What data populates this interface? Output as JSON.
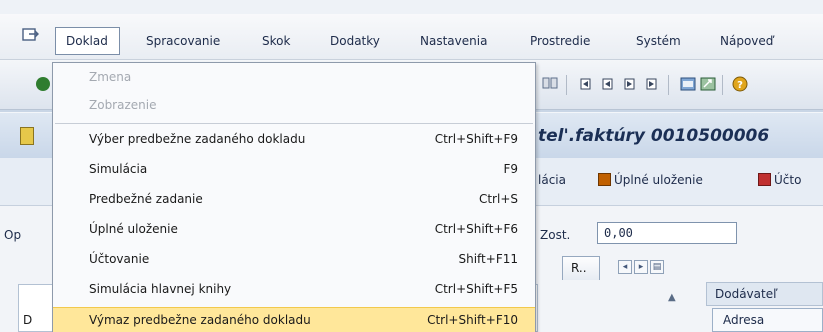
{
  "menubar": {
    "items": [
      {
        "label": "Doklad"
      },
      {
        "label": "Spracovanie"
      },
      {
        "label": "Skok"
      },
      {
        "label": "Dodatky"
      },
      {
        "label": "Nastavenia"
      },
      {
        "label": "Prostredie"
      },
      {
        "label": "Systém"
      },
      {
        "label": "Nápoveď"
      }
    ]
  },
  "title": {
    "text": "tel'.faktúry 0010500006"
  },
  "app_toolbar": {
    "simulacia_partial": "lácia",
    "full_save": "Úplné uloženie",
    "post_partial": "Účto"
  },
  "form": {
    "op_label": "Op",
    "zost_label": "Zost.",
    "zost_value": "0,00",
    "tab_r_label": "R..",
    "dodavatel_header": "Dodávateľ",
    "adresa_label": "Adresa",
    "left_panel_letter": "D"
  },
  "dropdown": {
    "items": [
      {
        "label": "Zmena",
        "shortcut": "",
        "disabled": true
      },
      {
        "label": "Zobrazenie",
        "shortcut": "",
        "disabled": true
      },
      {
        "label": "Výber predbežne zadaného dokladu",
        "shortcut": "Ctrl+Shift+F9",
        "disabled": false
      },
      {
        "label": "Simulácia",
        "shortcut": "F9",
        "disabled": false
      },
      {
        "label": "Predbežné zadanie",
        "shortcut": "Ctrl+S",
        "disabled": false
      },
      {
        "label": "Úplné uloženie",
        "shortcut": "Ctrl+Shift+F6",
        "disabled": false
      },
      {
        "label": "Účtovanie",
        "shortcut": "Shift+F11",
        "disabled": false
      },
      {
        "label": "Simulácia hlavnej knihy",
        "shortcut": "Ctrl+Shift+F5",
        "disabled": false
      },
      {
        "label": "Výmaz predbežne zadaného dokladu",
        "shortcut": "Ctrl+Shift+F10",
        "disabled": false,
        "highlighted": true
      }
    ]
  },
  "colors": {
    "highlight": "#ffe79a",
    "title_text": "#1b2f55",
    "menu_text": "#1d2b4a"
  }
}
